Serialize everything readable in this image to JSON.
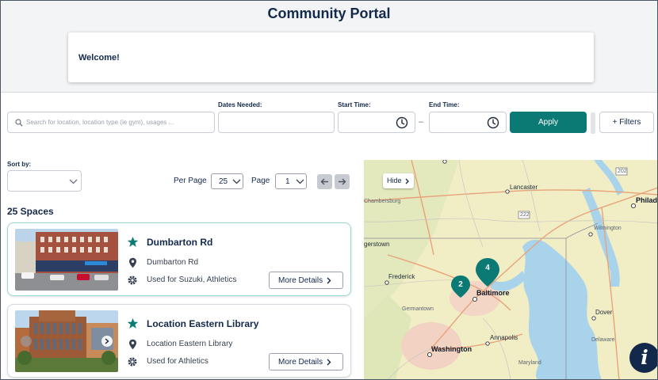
{
  "page": {
    "title": "Community Portal",
    "welcome": "Welcome!"
  },
  "filters": {
    "search_placeholder": "Search for location, location type (ie gym), usages ...",
    "dates_label": "Dates Needed:",
    "start_label": "Start Time:",
    "end_label": "End Time:",
    "separator": "–",
    "apply_label": "Apply",
    "filters_label": "+ Filters"
  },
  "sort": {
    "label": "Sort by:",
    "value": ""
  },
  "pagination": {
    "per_page_label": "Per Page",
    "per_page_value": "25",
    "page_label": "Page",
    "page_value": "1"
  },
  "results": {
    "count_title": "25 Spaces",
    "cards": [
      {
        "name": "Dumbarton Rd",
        "address": "Dumbarton Rd",
        "usage": "Used for Suzuki, Athletics",
        "more": "More Details"
      },
      {
        "name": "Location Eastern Library",
        "address": "Location Eastern Library",
        "usage": "Used for Athletics",
        "more": "More Details"
      }
    ]
  },
  "map": {
    "hide_label": "Hide",
    "places": {
      "philadelphia": "Philad",
      "lancaster": "Lancaster",
      "chambersburg": "Chambersburg",
      "wilmington": "Wilmington",
      "gettystown": "gerstown",
      "frederick": "Frederick",
      "baltimore": "Baltimore",
      "germantown": "Germantown",
      "dover": "Dover",
      "delaware": "Delaware",
      "annapolis": "Annapolis",
      "washington": "Washington",
      "maryland": "Maryland"
    },
    "route_shields": [
      "202",
      "222"
    ],
    "clusters": [
      {
        "count": "4"
      },
      {
        "count": "2"
      }
    ],
    "accent": "#0b7a75"
  },
  "colors": {
    "brand": "#13294b",
    "accent": "#0b7a75"
  },
  "icons": [
    "search-icon",
    "clock-icon",
    "chevron-down-icon",
    "arrow-left-icon",
    "arrow-right-icon",
    "star-icon",
    "location-pin-icon",
    "gear-icon",
    "info-icon"
  ]
}
